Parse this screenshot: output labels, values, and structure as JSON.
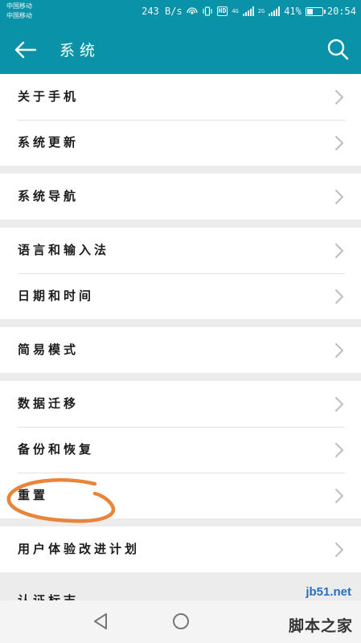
{
  "status_bar": {
    "carrier_1": "中国移动",
    "carrier_2": "中国移动",
    "net_speed": "243 B/s",
    "hd_badge": "HD",
    "net_4g": "4G",
    "net_2g": "2G",
    "battery_text": "41%",
    "battery_level": 0.41,
    "time": "20:54"
  },
  "header": {
    "title": "系统",
    "back_icon": "arrow-left-icon",
    "search_icon": "search-icon"
  },
  "groups": [
    {
      "items": [
        {
          "label": "关于手机"
        },
        {
          "label": "系统更新"
        }
      ]
    },
    {
      "items": [
        {
          "label": "系统导航"
        }
      ]
    },
    {
      "items": [
        {
          "label": "语言和输入法"
        },
        {
          "label": "日期和时间"
        }
      ]
    },
    {
      "items": [
        {
          "label": "简易模式"
        }
      ]
    },
    {
      "items": [
        {
          "label": "数据迁移"
        },
        {
          "label": "备份和恢复"
        },
        {
          "label": "重置"
        }
      ]
    },
    {
      "items": [
        {
          "label": "用户体验改进计划"
        }
      ]
    }
  ],
  "partial_item": {
    "label": "认证标志"
  },
  "highlight_color": "#e8853a",
  "accent_color": "#0a93a8",
  "nav_bar": {
    "back_icon": "triangle-back-icon",
    "home_icon": "circle-home-icon"
  },
  "watermark": {
    "url": "jb51.net",
    "name": "脚本之家"
  }
}
